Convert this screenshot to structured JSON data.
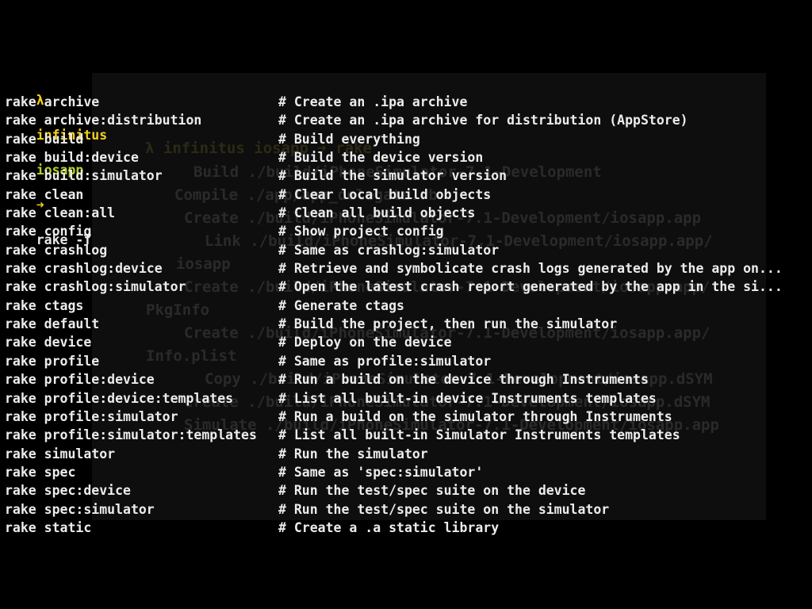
{
  "prompt": {
    "lambda": "λ",
    "host": "infinitus",
    "dir": "iosapp",
    "arrow": "➜",
    "command": "rake -T"
  },
  "tasks": [
    {
      "name": "rake archive",
      "desc": "# Create an .ipa archive"
    },
    {
      "name": "rake archive:distribution",
      "desc": "# Create an .ipa archive for distribution (AppStore)"
    },
    {
      "name": "rake build",
      "desc": "# Build everything"
    },
    {
      "name": "rake build:device",
      "desc": "# Build the device version"
    },
    {
      "name": "rake build:simulator",
      "desc": "# Build the simulator version"
    },
    {
      "name": "rake clean",
      "desc": "# Clear local build objects"
    },
    {
      "name": "rake clean:all",
      "desc": "# Clean all build objects"
    },
    {
      "name": "rake config",
      "desc": "# Show project config"
    },
    {
      "name": "rake crashlog",
      "desc": "# Same as crashlog:simulator"
    },
    {
      "name": "rake crashlog:device",
      "desc": "# Retrieve and symbolicate crash logs generated by the app on..."
    },
    {
      "name": "rake crashlog:simulator",
      "desc": "# Open the latest crash report generated by the app in the si..."
    },
    {
      "name": "rake ctags",
      "desc": "# Generate ctags"
    },
    {
      "name": "rake default",
      "desc": "# Build the project, then run the simulator"
    },
    {
      "name": "rake device",
      "desc": "# Deploy on the device"
    },
    {
      "name": "rake profile",
      "desc": "# Same as profile:simulator"
    },
    {
      "name": "rake profile:device",
      "desc": "# Run a build on the device through Instruments"
    },
    {
      "name": "rake profile:device:templates",
      "desc": "# List all built-in device Instruments templates"
    },
    {
      "name": "rake profile:simulator",
      "desc": "# Run a build on the simulator through Instruments"
    },
    {
      "name": "rake profile:simulator:templates",
      "desc": "# List all built-in Simulator Instruments templates"
    },
    {
      "name": "rake simulator",
      "desc": "# Run the simulator"
    },
    {
      "name": "rake spec",
      "desc": "# Same as 'spec:simulator'"
    },
    {
      "name": "rake spec:device",
      "desc": "# Run the test/spec suite on the device"
    },
    {
      "name": "rake spec:simulator",
      "desc": "# Run the test/spec suite on the simulator"
    },
    {
      "name": "rake static",
      "desc": "# Create a .a static library"
    }
  ],
  "ghost": {
    "prompt": "λ infinitus iosapp ➜ rake",
    "lines": [
      "Build ./build/iPhoneSimulator-7.1-Development",
      "Compile ./app/app_delegate.rb",
      "Create ./build/iPhoneSimulator-7.1-Development/iosapp.app",
      "Link ./build/iPhoneSimulator-7.1-Development/iosapp.app/",
      "iosapp",
      "Create ./build/iPhoneSimulator-7.1-Development/iosapp.app/",
      "PkgInfo",
      "Create ./build/iPhoneSimulator-7.1-Development/iosapp.app/",
      "Info.plist",
      "Copy ./build/iPhoneSimulator-7.1-Development/iosapp.dSYM",
      "Create ./build/iPhoneSimulator-7.1-Development/iosapp.dSYM",
      "Simulate ./build/iPhoneSimulator-7.1-Development/iosapp.app"
    ]
  },
  "colors": {
    "background": "#000000",
    "prompt_yellow": "#f2d01c",
    "prompt_green": "#b7d02a",
    "text": "#ececec"
  }
}
